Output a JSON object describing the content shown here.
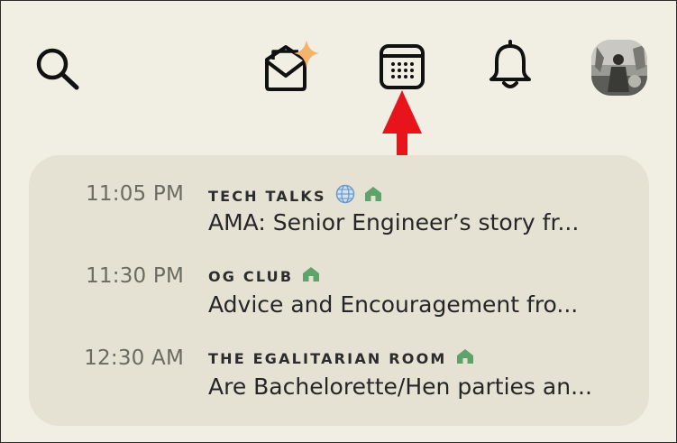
{
  "colors": {
    "background": "#f1efe4",
    "card": "#e5e2d4",
    "house_badge": "#5fa36a",
    "arrow": "#e8141b",
    "sparkle": "#f2b46d"
  },
  "icons": {
    "search": "search-icon",
    "invite": "envelope-sparkle-icon",
    "calendar": "calendar-icon",
    "notifications": "bell-icon",
    "profile": "avatar"
  },
  "events": [
    {
      "time": "11:05 PM",
      "club": "TECH TALKS",
      "has_globe": true,
      "title": "AMA: Senior Engineer’s story fr..."
    },
    {
      "time": "11:30 PM",
      "club": "OG CLUB",
      "has_globe": false,
      "title": "Advice and Encouragement fro..."
    },
    {
      "time": "12:30 AM",
      "club": "THE EGALITARIAN ROOM",
      "has_globe": false,
      "title": "Are Bachelorette/Hen parties an..."
    }
  ]
}
